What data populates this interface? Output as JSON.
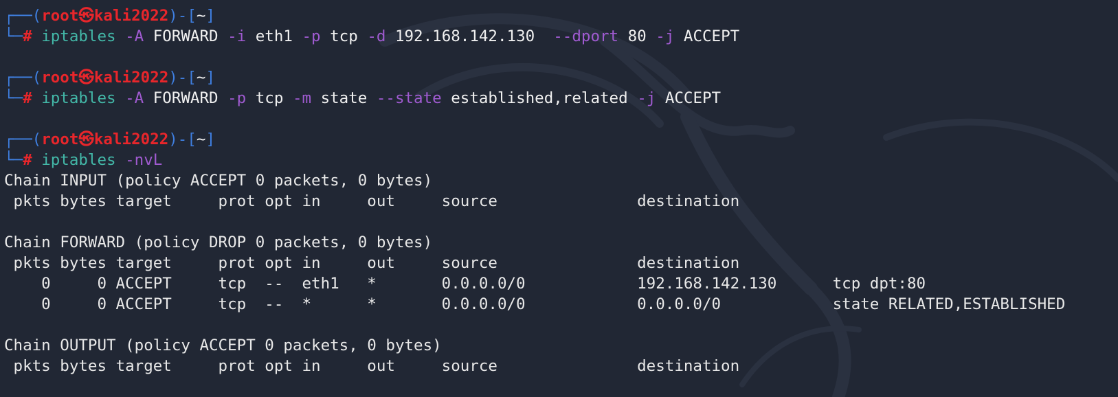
{
  "colors": {
    "background": "#212734",
    "prompt_box": "#3f7fe0",
    "prompt_user": "#e8262b",
    "command": "#43b8a8",
    "option": "#a05bd1",
    "output": "#e8e8e8"
  },
  "prompt": {
    "open": "┌──(",
    "user": "root",
    "separator_icon": "㉿",
    "host": "kali2022",
    "mid": ")-[",
    "cwd": "~",
    "close": "]",
    "second_line_prefix": "└─",
    "hash": "#"
  },
  "commands": [
    {
      "tokens": [
        {
          "type": "cmd",
          "text": "iptables"
        },
        {
          "type": "plain",
          "text": " "
        },
        {
          "type": "opt",
          "text": "-A"
        },
        {
          "type": "plain",
          "text": " FORWARD "
        },
        {
          "type": "opt",
          "text": "-i"
        },
        {
          "type": "plain",
          "text": " eth1 "
        },
        {
          "type": "opt",
          "text": "-p"
        },
        {
          "type": "plain",
          "text": " tcp "
        },
        {
          "type": "opt",
          "text": "-d"
        },
        {
          "type": "plain",
          "text": " 192.168.142.130  "
        },
        {
          "type": "opt",
          "text": "--dport"
        },
        {
          "type": "plain",
          "text": " 80 "
        },
        {
          "type": "opt",
          "text": "-j"
        },
        {
          "type": "plain",
          "text": " ACCEPT"
        }
      ]
    },
    {
      "tokens": [
        {
          "type": "cmd",
          "text": "iptables"
        },
        {
          "type": "plain",
          "text": " "
        },
        {
          "type": "opt",
          "text": "-A"
        },
        {
          "type": "plain",
          "text": " FORWARD "
        },
        {
          "type": "opt",
          "text": "-p"
        },
        {
          "type": "plain",
          "text": " tcp "
        },
        {
          "type": "opt",
          "text": "-m"
        },
        {
          "type": "plain",
          "text": " state "
        },
        {
          "type": "opt",
          "text": "--state"
        },
        {
          "type": "plain",
          "text": " established,related "
        },
        {
          "type": "opt",
          "text": "-j"
        },
        {
          "type": "plain",
          "text": " ACCEPT"
        }
      ]
    },
    {
      "tokens": [
        {
          "type": "cmd",
          "text": "iptables"
        },
        {
          "type": "plain",
          "text": " "
        },
        {
          "type": "opt",
          "text": "-nvL"
        }
      ]
    }
  ],
  "output": {
    "chains": [
      {
        "header": "Chain INPUT (policy ACCEPT 0 packets, 0 bytes)",
        "columns": " pkts bytes target     prot opt in     out     source               destination",
        "rows": []
      },
      {
        "header": "Chain FORWARD (policy DROP 0 packets, 0 bytes)",
        "columns": " pkts bytes target     prot opt in     out     source               destination",
        "rows": [
          "    0     0 ACCEPT     tcp  --  eth1   *       0.0.0.0/0            192.168.142.130      tcp dpt:80",
          "    0     0 ACCEPT     tcp  --  *      *       0.0.0.0/0            0.0.0.0/0            state RELATED,ESTABLISHED"
        ]
      },
      {
        "header": "Chain OUTPUT (policy ACCEPT 0 packets, 0 bytes)",
        "columns": " pkts bytes target     prot opt in     out     source               destination",
        "rows": []
      }
    ]
  }
}
